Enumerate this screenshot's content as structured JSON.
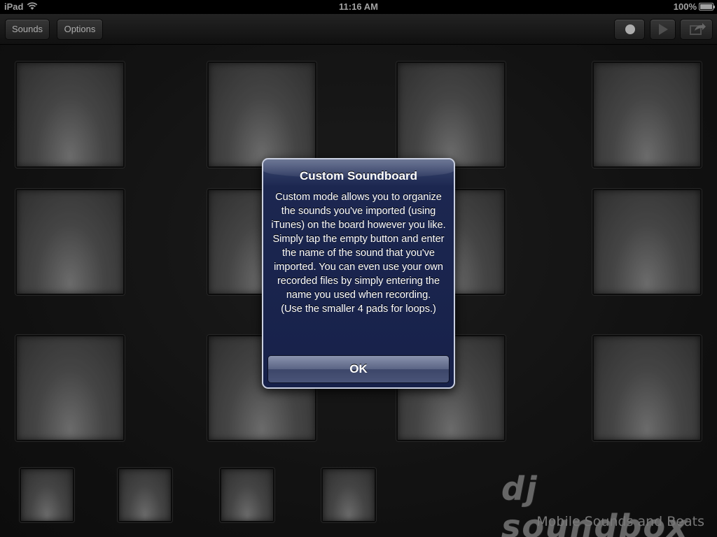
{
  "status_bar": {
    "carrier": "iPad",
    "time": "11:16 AM",
    "battery": "100%"
  },
  "toolbar": {
    "sounds_label": "Sounds",
    "options_label": "Options",
    "icons": [
      "record-icon",
      "play-icon",
      "share-icon"
    ]
  },
  "branding": {
    "logo_text": "dj soundbox",
    "tagline": "Mobile Sounds and Beats"
  },
  "alert": {
    "title": "Custom Soundboard",
    "message": "Custom mode allows you to organize the sounds you've imported (using iTunes) on the board however you like.\nSimply tap the empty button and enter the name of the sound that you've imported. You can even use your own recorded files by simply entering the name you used when recording.\n(Use the smaller 4 pads for loops.)",
    "ok_label": "OK"
  },
  "pads": {
    "large_count": 12,
    "small_count": 4
  }
}
